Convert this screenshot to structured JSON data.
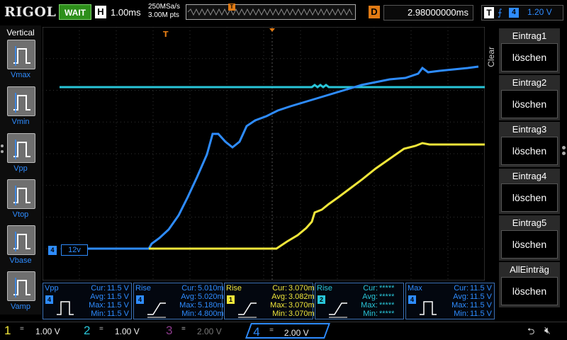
{
  "header": {
    "logo": "RIGOL",
    "run_status": "WAIT",
    "timebase_badge": "H",
    "timebase": "1.00ms",
    "sample_rate": "250MSa/s",
    "memory_depth": "3.00M pts",
    "delay_badge": "D",
    "delay_value": "2.98000000ms",
    "trigger_badge": "T",
    "trigger_edge": "rising-edge-icon",
    "trigger_source": "4",
    "trigger_level": "1.20 V"
  },
  "left_panel": {
    "title": "Vertical",
    "items": [
      {
        "label": "Vmax",
        "icon": "vmax-icon"
      },
      {
        "label": "Vmin",
        "icon": "vmin-icon"
      },
      {
        "label": "Vpp",
        "icon": "vpp-icon"
      },
      {
        "label": "Vtop",
        "icon": "vtop-icon"
      },
      {
        "label": "Vbase",
        "icon": "vbase-icon"
      },
      {
        "label": "Vamp",
        "icon": "vamp-icon"
      }
    ]
  },
  "ch4_marker": {
    "badge": "4",
    "label": "12v"
  },
  "right_menu": {
    "side_label": "Clear",
    "items": [
      {
        "title": "Eintrag1",
        "button": "löschen"
      },
      {
        "title": "Eintrag2",
        "button": "löschen"
      },
      {
        "title": "Eintrag3",
        "button": "löschen"
      },
      {
        "title": "Eintrag4",
        "button": "löschen"
      },
      {
        "title": "Eintrag5",
        "button": "löschen"
      },
      {
        "title": "AllEinträg",
        "button": "löschen"
      }
    ]
  },
  "measurements": [
    {
      "name": "Vpp",
      "channel": "4",
      "color": "#2e8cff",
      "rows": [
        [
          "Cur:",
          "11.5 V"
        ],
        [
          "Avg:",
          "11.5 V"
        ],
        [
          "Max:",
          "11.5 V"
        ],
        [
          "Min:",
          "11.5 V"
        ]
      ]
    },
    {
      "name": "Rise",
      "channel": "4",
      "color": "#2e8cff",
      "rows": [
        [
          "Cur:",
          "5.010ms"
        ],
        [
          "Avg:",
          "5.020ms"
        ],
        [
          "Max:",
          "5.180ms"
        ],
        [
          "Min:",
          "4.800ms"
        ]
      ]
    },
    {
      "name": "Rise",
      "channel": "1",
      "color": "#f0e63a",
      "rows": [
        [
          "Cur:",
          "3.070ms"
        ],
        [
          "Avg:",
          "3.082ms"
        ],
        [
          "Max:",
          "3.070ms"
        ],
        [
          "Min:",
          "3.070ms"
        ]
      ]
    },
    {
      "name": "Rise",
      "channel": "2",
      "color": "#29c5d8",
      "rows": [
        [
          "Cur:",
          "*****"
        ],
        [
          "Avg:",
          "*****"
        ],
        [
          "Max:",
          "*****"
        ],
        [
          "Min:",
          "*****"
        ]
      ]
    },
    {
      "name": "Max",
      "channel": "4",
      "color": "#2e8cff",
      "rows": [
        [
          "Cur:",
          "11.5 V"
        ],
        [
          "Avg:",
          "11.5 V"
        ],
        [
          "Max:",
          "11.5 V"
        ],
        [
          "Min:",
          "11.5 V"
        ]
      ]
    }
  ],
  "channels": [
    {
      "num": "1",
      "coupling": "=",
      "scale": "1.00 V",
      "color": "#f0e63a"
    },
    {
      "num": "2",
      "coupling": "=",
      "scale": "1.00 V",
      "color": "#29c5d8"
    },
    {
      "num": "3",
      "coupling": "=",
      "scale": "2.00 V",
      "color": "#8a3a8a"
    },
    {
      "num": "4",
      "coupling": "=",
      "scale": "2.00 V",
      "color": "#2e8cff"
    }
  ],
  "status_icons": {
    "usb": "usb-icon",
    "speaker": "speaker-muted-icon"
  },
  "colors": {
    "ch1": "#f0e63a",
    "ch2": "#29c5d8",
    "ch3": "#8a3a8a",
    "ch4": "#2e8cff",
    "trigger_marker": "#e07a14",
    "run_status_bg": "#2d8f1a"
  }
}
